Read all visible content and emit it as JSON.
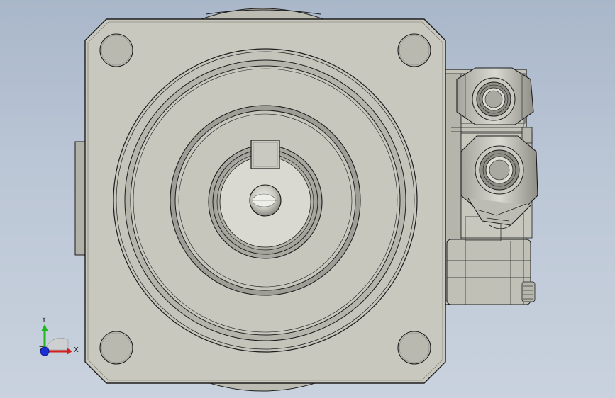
{
  "scene": {
    "background_top": "#a9b7ca",
    "background_bottom": "#c9d2de",
    "part_fill": "#c6c6bd",
    "part_shadow": "#9c9c93",
    "edge_color": "#1c1c1c",
    "hole_fill": "#b4b4ab",
    "thread_fill": "#8d8d85"
  },
  "triad": {
    "x_label": "X",
    "y_label": "Y",
    "z_label": "Z",
    "x_color": "#d62020",
    "y_color": "#22b522",
    "z_color": "#1c2fd6"
  }
}
